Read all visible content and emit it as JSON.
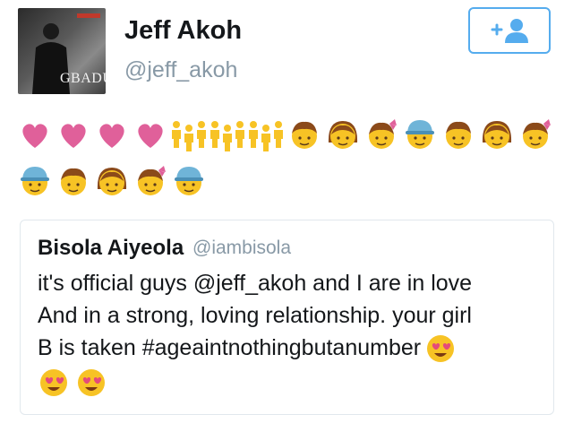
{
  "profile": {
    "name": "Jeff Akoh",
    "handle": "@jeff_akoh",
    "avatar_text": "GBADUN",
    "follow_icon": "add-user-icon"
  },
  "emoji_rows": [
    [
      "heart",
      "heart",
      "heart",
      "heart",
      "family",
      "family",
      "family",
      "boy",
      "girl",
      "girl-bow",
      "boy-cap",
      "boy",
      "girl",
      "girl-bow"
    ],
    [
      "boy-cap",
      "boy",
      "girl",
      "girl-bow",
      "boy-cap"
    ]
  ],
  "quoted_tweet": {
    "name": "Bisola Aiyeola",
    "handle": "@iambisola",
    "lines": [
      "it's official guys @jeff_akoh and I are in love",
      "And in a strong, loving relationship. your girl",
      "B is taken #ageaintnothingbutanumber"
    ],
    "trailing_emoji": [
      "heart-eyes",
      "heart-eyes",
      "heart-eyes"
    ]
  },
  "colors": {
    "accent": "#55acee",
    "heart": "#e0609a",
    "muted": "#8899a6",
    "face": "#f7c325",
    "hair": "#8b4a1a"
  }
}
